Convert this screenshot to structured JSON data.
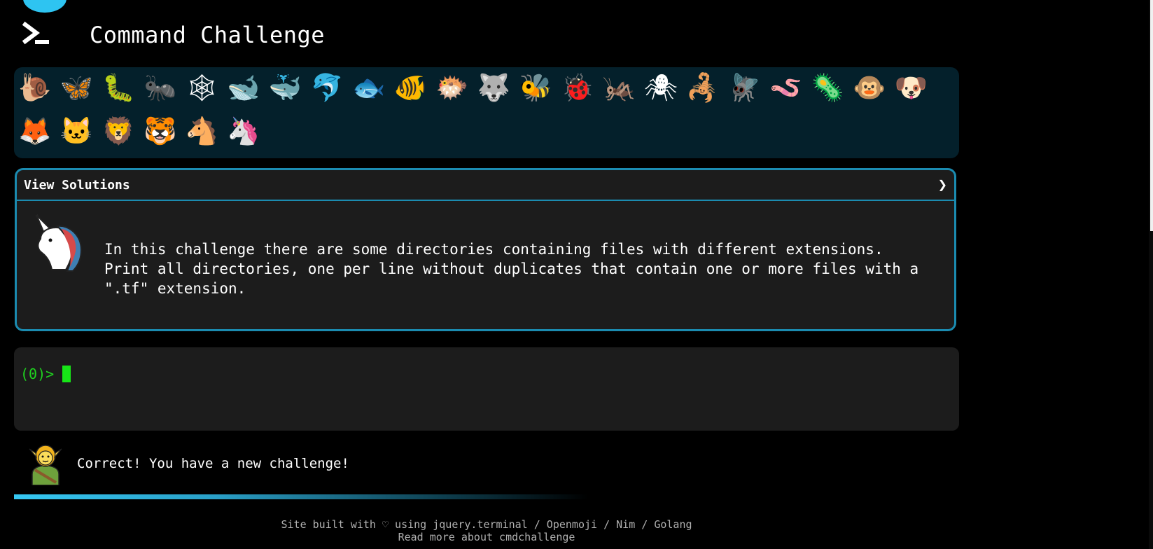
{
  "header": {
    "title": "Command Challenge"
  },
  "badges": [
    {
      "name": "snail",
      "glyph": "🐌"
    },
    {
      "name": "butterfly",
      "glyph": "🦋"
    },
    {
      "name": "caterpillar",
      "glyph": "🐛"
    },
    {
      "name": "ant",
      "glyph": "🐜"
    },
    {
      "name": "spider-web",
      "glyph": "🕸"
    },
    {
      "name": "whale",
      "glyph": "🐋"
    },
    {
      "name": "spouting-whale",
      "glyph": "🐳"
    },
    {
      "name": "dolphin",
      "glyph": "🐬"
    },
    {
      "name": "fish",
      "glyph": "🐟"
    },
    {
      "name": "tropical-fish",
      "glyph": "🐠"
    },
    {
      "name": "blowfish",
      "glyph": "🐡"
    },
    {
      "name": "wolf",
      "glyph": "🐺"
    },
    {
      "name": "bee",
      "glyph": "🐝"
    },
    {
      "name": "lady-beetle",
      "glyph": "🐞"
    },
    {
      "name": "cricket",
      "glyph": "🦗"
    },
    {
      "name": "spider",
      "glyph": "🕷"
    },
    {
      "name": "scorpion",
      "glyph": "🦂"
    },
    {
      "name": "fly",
      "glyph": "🪰"
    },
    {
      "name": "worm",
      "glyph": "🪱"
    },
    {
      "name": "microbe",
      "glyph": "🦠"
    },
    {
      "name": "monkey",
      "glyph": "🐵"
    },
    {
      "name": "dog",
      "glyph": "🐶"
    },
    {
      "name": "fox",
      "glyph": "🦊"
    },
    {
      "name": "cat",
      "glyph": "🐱"
    },
    {
      "name": "lion",
      "glyph": "🦁"
    },
    {
      "name": "tiger",
      "glyph": "🐯"
    },
    {
      "name": "horse",
      "glyph": "🐴"
    },
    {
      "name": "unicorn",
      "glyph": "🦄"
    }
  ],
  "solutions": {
    "title": "View Solutions",
    "chevron": "❯",
    "challenge_text": "In this challenge there are some directories containing files with different extensions.\nPrint all directories, one per line without duplicates that contain one or more files with a\n\".tf\" extension."
  },
  "terminal": {
    "prompt": "(0)>"
  },
  "status": {
    "message": "Correct! You have a new challenge!"
  },
  "progress": {
    "fraction": 0.5
  },
  "footer": {
    "line1_prefix": "Site built with ♡ using ",
    "link_jquery": "jquery.terminal",
    "sep1": " / ",
    "link_openmoji": "Openmoji",
    "sep2": " / ",
    "link_nim": "Nim",
    "sep3": " / ",
    "link_golang": "Golang",
    "line2": "Read more about cmdchallenge"
  },
  "colors": {
    "accent": "#1b8bb0",
    "prompt_green": "#1fd21f",
    "badge_bg": "#04202b",
    "panel_bg": "#1c1c1c"
  }
}
